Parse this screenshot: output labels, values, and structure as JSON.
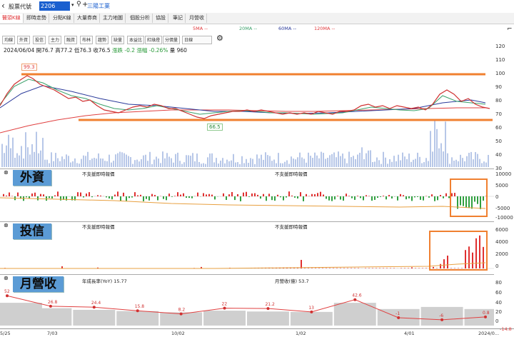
{
  "header": {
    "back_icon": "chevron-left-icon",
    "label": "股票代號",
    "code": "2206",
    "search_icon": "magnifier-icon",
    "add_icon": "plus-icon",
    "stock_name": "三陽工業"
  },
  "tabs": [
    {
      "label": "醫頭K線",
      "active": true
    },
    {
      "label": "即時走勢"
    },
    {
      "label": "分點K線"
    },
    {
      "label": "大量券商"
    },
    {
      "label": "主力地圖"
    },
    {
      "label": "個股分析"
    },
    {
      "label": "協設"
    },
    {
      "label": "筆記"
    },
    {
      "label": "月營收"
    }
  ],
  "toolbar": {
    "chips": [
      "均線",
      "外資",
      "投信",
      "主力",
      "融資",
      "布林",
      "趨勢",
      "缺量",
      "本益比",
      "紅綠燈",
      "分價量"
    ],
    "period": "日線",
    "gear_icon": "gear-icon",
    "ma": [
      {
        "label": "5MA --",
        "color": "#e0373a"
      },
      {
        "label": "20MA --",
        "color": "#3aa06a"
      },
      {
        "label": "60MA --",
        "color": "#2a3a9a"
      },
      {
        "label": "120MA --",
        "color": "#e0373a"
      }
    ],
    "corner_icon": "tool-icon"
  },
  "quote": {
    "date": "2024/06/04",
    "open_label": "開",
    "open": "76.7",
    "high_label": "高",
    "high": "77.2",
    "low_label": "低",
    "low": "76.3",
    "close_label": "收",
    "close": "76.5",
    "change_label": "漲跌",
    "change": "-0.2",
    "pct_label": "漲幅",
    "pct": "-0.26%",
    "vol_label": "量",
    "vol": "960"
  },
  "annotations": {
    "high": "99.3",
    "low": "66.5"
  },
  "main_axis": [
    "120",
    "110",
    "100",
    "90",
    "80",
    "70",
    "60",
    "50",
    "40",
    "30"
  ],
  "foreign": {
    "title": "外資",
    "legend1": "不支援即時報價",
    "legend2": "不支援即時報價",
    "axis": [
      "10000",
      "5000",
      "0",
      "-5000",
      "-10000"
    ]
  },
  "trust": {
    "title": "投信",
    "legend1": "不支援即時報價",
    "legend2": "不支援即時報價",
    "axis": [
      "6000",
      "4000",
      "2000",
      "0"
    ]
  },
  "revenue": {
    "title": "月營收",
    "yoy_label": "年成長率(YoY) 15.77",
    "rev_label": "月營收(億) 53.7",
    "axis": [
      "80",
      "60",
      "40",
      "20",
      "0",
      "-20"
    ],
    "points": [
      "52",
      "26.8",
      "24.4",
      "15.8",
      "8.2",
      "22",
      "21.2",
      "13",
      "42.6",
      "-1",
      "-6",
      "0.8"
    ],
    "bar_pct": [
      0.55,
      0.42,
      0.38,
      0.35,
      0.32,
      0.36,
      0.34,
      0.33,
      0.55,
      0.4,
      0.45,
      0.4
    ]
  },
  "xaxis": [
    "5/25",
    "7/03",
    "10/02",
    "1/02",
    "4/01",
    "2024/0..."
  ],
  "xaxis_last_value": "-14.8"
}
